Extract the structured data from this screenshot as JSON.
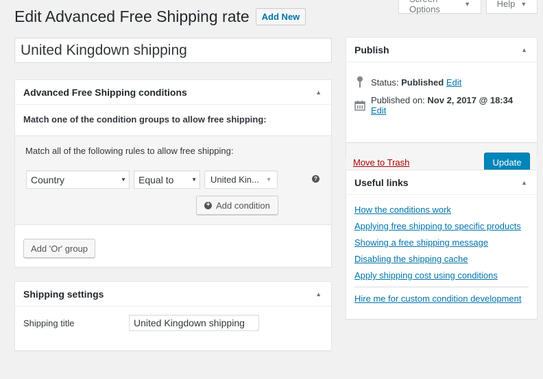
{
  "screen_meta": {
    "screen_options_label": "Screen Options",
    "help_label": "Help"
  },
  "header": {
    "title": "Edit Advanced Free Shipping rate",
    "add_new_label": "Add New"
  },
  "post_title": {
    "value": "United Kingdown shipping"
  },
  "conditions_box": {
    "title": "Advanced Free Shipping conditions",
    "match_one_text": "Match one of the condition groups to allow free shipping:",
    "group": {
      "match_all_text": "Match all of the following rules to allow free shipping:",
      "rules": [
        {
          "condition": "Country",
          "operator": "Equal to",
          "value": "United Kin..."
        }
      ],
      "help_icon": "question-circle-icon",
      "add_condition_label": "Add condition"
    },
    "add_or_group_label": "Add 'Or' group"
  },
  "shipping_settings": {
    "title": "Shipping settings",
    "shipping_title_label": "Shipping title",
    "shipping_title_value": "United Kingdown shipping"
  },
  "publish": {
    "title": "Publish",
    "status_label": "Status:",
    "status_value": "Published",
    "status_edit": "Edit",
    "published_on_label": "Published on:",
    "published_on_value": "Nov 2, 2017 @ 18:34",
    "published_edit": "Edit",
    "trash_label": "Move to Trash",
    "update_label": "Update"
  },
  "useful_links": {
    "title": "Useful links",
    "links": [
      "How the conditions work",
      "Applying free shipping to specific products",
      "Showing a free shipping message",
      "Disabling the shipping cache",
      "Apply shipping cost using conditions"
    ],
    "hire_link": "Hire me for custom condition development"
  },
  "colors": {
    "accent": "#0073aa",
    "primary_button": "#0085ba",
    "trash": "#a00000",
    "background": "#f1f1f1"
  }
}
